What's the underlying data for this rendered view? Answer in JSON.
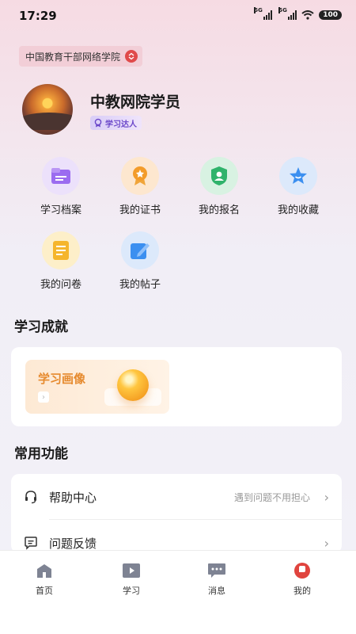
{
  "status_bar": {
    "time": "17:29",
    "signal_1": "5G",
    "signal_2": "5G",
    "battery": "100"
  },
  "org": {
    "name": "中国教育干部网络学院",
    "switch_icon": "switch-icon"
  },
  "profile": {
    "name": "中教网院学员",
    "badge": "学习达人",
    "badge_icon": "medal-icon"
  },
  "quick_actions": [
    {
      "label": "学习档案",
      "icon": "folder-icon",
      "color": "#9b6cf0"
    },
    {
      "label": "我的证书",
      "icon": "certificate-icon",
      "color": "#f39c2a"
    },
    {
      "label": "我的报名",
      "icon": "registration-icon",
      "color": "#2fb36b"
    },
    {
      "label": "我的收藏",
      "icon": "star-icon",
      "color": "#3b8ff0"
    },
    {
      "label": "我的问卷",
      "icon": "survey-icon",
      "color": "#f5b52c"
    },
    {
      "label": "我的帖子",
      "icon": "post-icon",
      "color": "#3b8ff0"
    }
  ],
  "achievements": {
    "title": "学习成就",
    "portrait_label": "学习画像"
  },
  "functions": {
    "title": "常用功能",
    "items": [
      {
        "label": "帮助中心",
        "hint": "遇到问题不用担心",
        "icon": "headset-icon"
      },
      {
        "label": "问题反馈",
        "hint": "",
        "icon": "feedback-icon"
      }
    ]
  },
  "tab_bar": {
    "tabs": [
      {
        "label": "首页",
        "icon": "home-icon"
      },
      {
        "label": "学习",
        "icon": "play-icon"
      },
      {
        "label": "消息",
        "icon": "message-icon"
      },
      {
        "label": "我的",
        "icon": "profile-icon",
        "active": true
      }
    ],
    "active_color": "#e0443e"
  }
}
